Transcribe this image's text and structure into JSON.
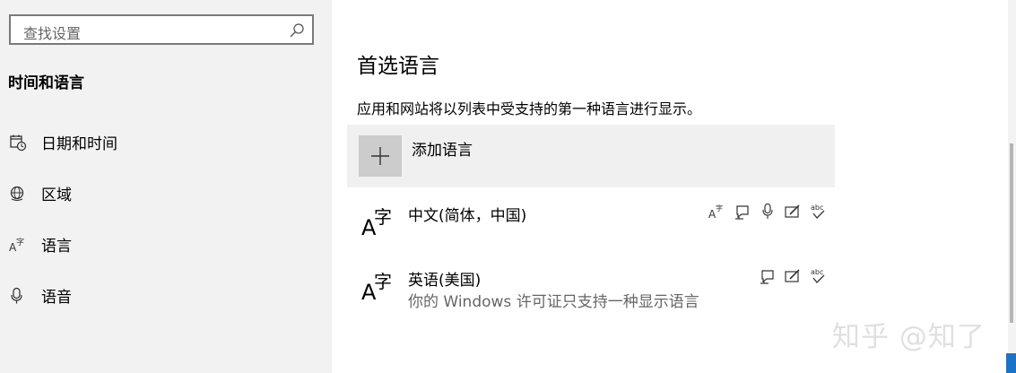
{
  "sidebar": {
    "search_placeholder": "查找设置",
    "section_title": "时间和语言",
    "items": [
      {
        "label": "日期和时间",
        "icon": "calendar-clock-icon"
      },
      {
        "label": "区域",
        "icon": "globe-icon"
      },
      {
        "label": "语言",
        "icon": "language-icon"
      },
      {
        "label": "语音",
        "icon": "microphone-icon"
      }
    ]
  },
  "main": {
    "title": "首选语言",
    "description": "应用和网站将以列表中受支持的第一种语言进行显示。",
    "add_language_label": "添加语言",
    "languages": [
      {
        "name": "中文(简体，中国)",
        "subtitle": "",
        "features": [
          "display-language-icon",
          "text-to-speech-icon",
          "speech-recognition-icon",
          "handwriting-icon",
          "spell-check-icon"
        ]
      },
      {
        "name": "英语(美国)",
        "subtitle": "你的 Windows 许可证只支持一种显示语言",
        "features": [
          "text-to-speech-icon",
          "handwriting-icon",
          "spell-check-icon"
        ]
      }
    ]
  },
  "lang_glyph": {
    "a": "A",
    "zi": "字"
  },
  "abc_text": "abc",
  "watermark": "知乎 @知了",
  "colors": {
    "sidebar_bg": "#f2f2f2",
    "add_row_bg": "#f0f0f0",
    "add_button_bg": "#cccccc",
    "corner_tag": "#1a73c8"
  }
}
